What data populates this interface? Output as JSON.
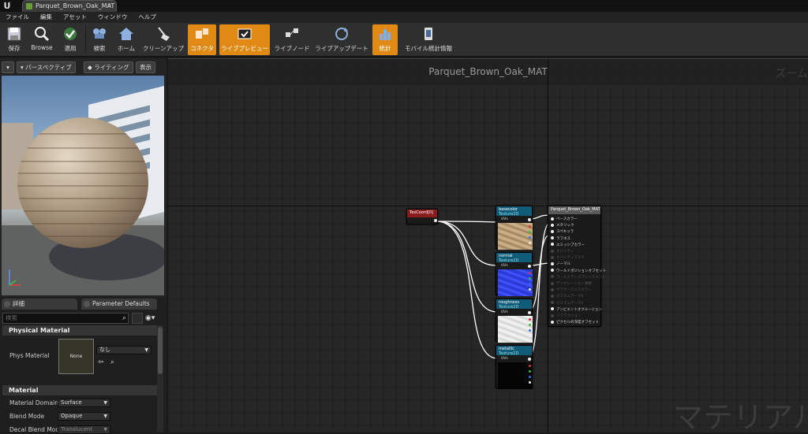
{
  "title_bar": {
    "logo": "U",
    "doc_tab": "Parquet_Brown_Oak_MAT",
    "close": "×"
  },
  "menu": [
    "ファイル",
    "編集",
    "アセット",
    "ウィンドウ",
    "ヘルプ"
  ],
  "toolbar": [
    {
      "label": "保存",
      "icon": "save-icon",
      "active": false
    },
    {
      "label": "Browse",
      "icon": "browse-icon",
      "active": false
    },
    {
      "label": "適用",
      "icon": "apply-icon",
      "active": false
    },
    {
      "label": "検索",
      "icon": "search-icon",
      "active": false
    },
    {
      "label": "ホーム",
      "icon": "home-icon",
      "active": false
    },
    {
      "label": "クリーンアップ",
      "icon": "cleanup-icon",
      "active": false
    },
    {
      "label": "コネクタ",
      "icon": "connector-icon",
      "active": true
    },
    {
      "label": "ライブプレビュー",
      "icon": "live-preview-icon",
      "active": true
    },
    {
      "label": "ライブノード",
      "icon": "live-node-icon",
      "active": false
    },
    {
      "label": "ライブアップデート",
      "icon": "live-update-icon",
      "active": false
    },
    {
      "label": "統計",
      "icon": "stats-icon",
      "active": true
    },
    {
      "label": "モバイル統計情報",
      "icon": "mobile-stats-icon",
      "active": false
    }
  ],
  "viewport": {
    "perspective": "パースペクティブ",
    "lighting": "ライティング",
    "show": "表示"
  },
  "details": {
    "tab_details": "詳細",
    "tab_params": "Parameter Defaults",
    "search_placeholder": "検索",
    "section_physical": "Physical Material",
    "phys_material_label": "Phys Material",
    "phys_material_thumb": "None",
    "phys_material_value": "なし",
    "section_material": "Material",
    "material_domain_label": "Material Domain",
    "material_domain_value": "Surface",
    "blend_mode_label": "Blend Mode",
    "blend_mode_value": "Opaque",
    "decal_blend_label": "Decal Blend Mode",
    "decal_blend_value": "Translucent"
  },
  "graph": {
    "title": "Parquet_Brown_Oak_MAT",
    "zoom_label": "ズーム",
    "watermark": "マテリアル",
    "texcoord_label": "TexCoord[0]",
    "nodes": [
      {
        "name": "basecolor",
        "sub": "Texture2D",
        "uv": "UVs",
        "color": "#c1a27a"
      },
      {
        "name": "normal",
        "sub": "Texture2D",
        "uv": "UVs",
        "color": "#2a3bd6"
      },
      {
        "name": "roughness",
        "sub": "Texture2D",
        "uv": "UVs",
        "color": "#eaeaea"
      },
      {
        "name": "metallic",
        "sub": "Texture2D",
        "uv": "UVs",
        "color": "#050505"
      }
    ],
    "result_node": {
      "title": "Parquet_Brown_Oak_MAT",
      "inputs": [
        "ベースカラー",
        "メタリック",
        "スペキュラ",
        "ラフネス",
        "エミッシブカラー",
        "オパシティ",
        "オパシティマスク",
        "ノーマル",
        "ワールドポジションオフセット",
        "ワールドディスプレイスメント",
        "テッセレーション乗数",
        "サブサーフェスカラー",
        "カスタムデータ0",
        "カスタムデータ1",
        "アンビエントオクルージョン",
        "リフラクション",
        "ピクセルの深度オフセット"
      ],
      "enabled": [
        true,
        true,
        true,
        true,
        true,
        false,
        false,
        true,
        true,
        false,
        false,
        false,
        false,
        false,
        true,
        false,
        true
      ]
    }
  }
}
